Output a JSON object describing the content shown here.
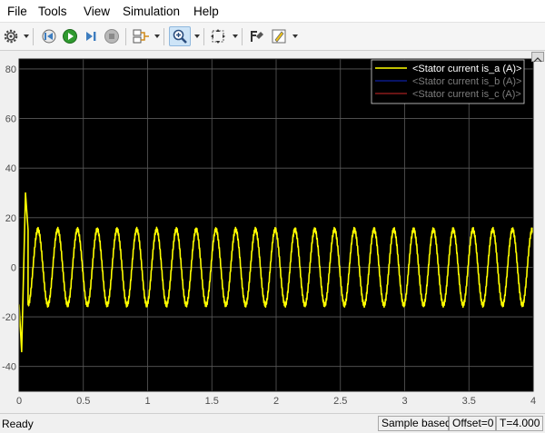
{
  "menu": [
    "File",
    "Tools",
    "View",
    "Simulation",
    "Help"
  ],
  "toolbar": {
    "icons": [
      "gear-icon",
      "step-back-icon",
      "run-icon",
      "step-forward-icon",
      "stop-icon",
      "signal-select-icon",
      "zoom-icon",
      "fit-view-icon",
      "style-icon",
      "highlight-icon"
    ]
  },
  "colors": {
    "plot_background": "#000000",
    "axes_border": "#1c1c1c",
    "grid": "#5a5a5a",
    "tick_label": "#4d4d4d",
    "series_a": "#ffff00",
    "series_b": "#0b1a88",
    "series_c": "#8a1a1a",
    "legend_a_text": "#ffffff",
    "legend_b_text": "#7d7d7d",
    "legend_c_text": "#7d7d7d"
  },
  "chart_data": {
    "type": "line",
    "title": "",
    "xlabel": "",
    "ylabel": "",
    "xlim": [
      0,
      4
    ],
    "ylim": [
      -50,
      84
    ],
    "xticks": [
      0,
      0.5,
      1,
      1.5,
      2,
      2.5,
      3,
      3.5,
      4
    ],
    "xtick_labels": [
      "0",
      "0.5",
      "1",
      "1.5",
      "2",
      "2.5",
      "3",
      "3.5",
      "4"
    ],
    "yticks": [
      -40,
      -20,
      0,
      20,
      40,
      60,
      80
    ],
    "ytick_labels": [
      "-40",
      "-20",
      "0",
      "20",
      "40",
      "60",
      "80"
    ],
    "grid": true,
    "legend_position": "top-right",
    "series": [
      {
        "name": "<Stator current is_a (A)>",
        "color": "#ffff00",
        "x": [
          0.0,
          0.02,
          0.05,
          0.07,
          0.14,
          0.22,
          0.3,
          0.38,
          0.46,
          0.54,
          0.62,
          0.7,
          0.78,
          0.86,
          0.94,
          1.02,
          1.1,
          1.18,
          1.26,
          1.34,
          1.42,
          1.5,
          1.58,
          1.66,
          1.74,
          1.82,
          1.9,
          1.98,
          2.06,
          2.14,
          2.22,
          2.3,
          2.38,
          2.46,
          2.54,
          2.62,
          2.7,
          2.78,
          2.86,
          2.94,
          3.02,
          3.1,
          3.18,
          3.26,
          3.34,
          3.42,
          3.5,
          3.58,
          3.66,
          3.74,
          3.82,
          3.9,
          3.98,
          4.0
        ],
        "y": [
          -15,
          -34,
          30,
          15,
          -16,
          -16,
          -15,
          -14,
          -14,
          -14,
          -14,
          -14,
          -14,
          -14,
          -14,
          -14,
          -14,
          -14,
          -14,
          -14,
          -14,
          -14,
          -14,
          -14,
          -14,
          -14,
          -14,
          -14,
          -14,
          -15,
          -15,
          -15,
          -15,
          -15,
          -15,
          -15,
          -15,
          -15,
          -15,
          -15,
          -15,
          -15,
          -15,
          -15,
          -15,
          -15,
          -15,
          -15,
          -15,
          -15,
          -15,
          -15,
          -15,
          15
        ]
      },
      {
        "name": "<Stator current is_b (A)>",
        "color": "#0b1a88"
      },
      {
        "name": "<Stator current is_c (A)>",
        "color": "#8a1a1a"
      }
    ]
  },
  "status": {
    "ready": "Ready",
    "mode": "Sample based",
    "offset": "Offset=0",
    "time": "T=4.000"
  }
}
